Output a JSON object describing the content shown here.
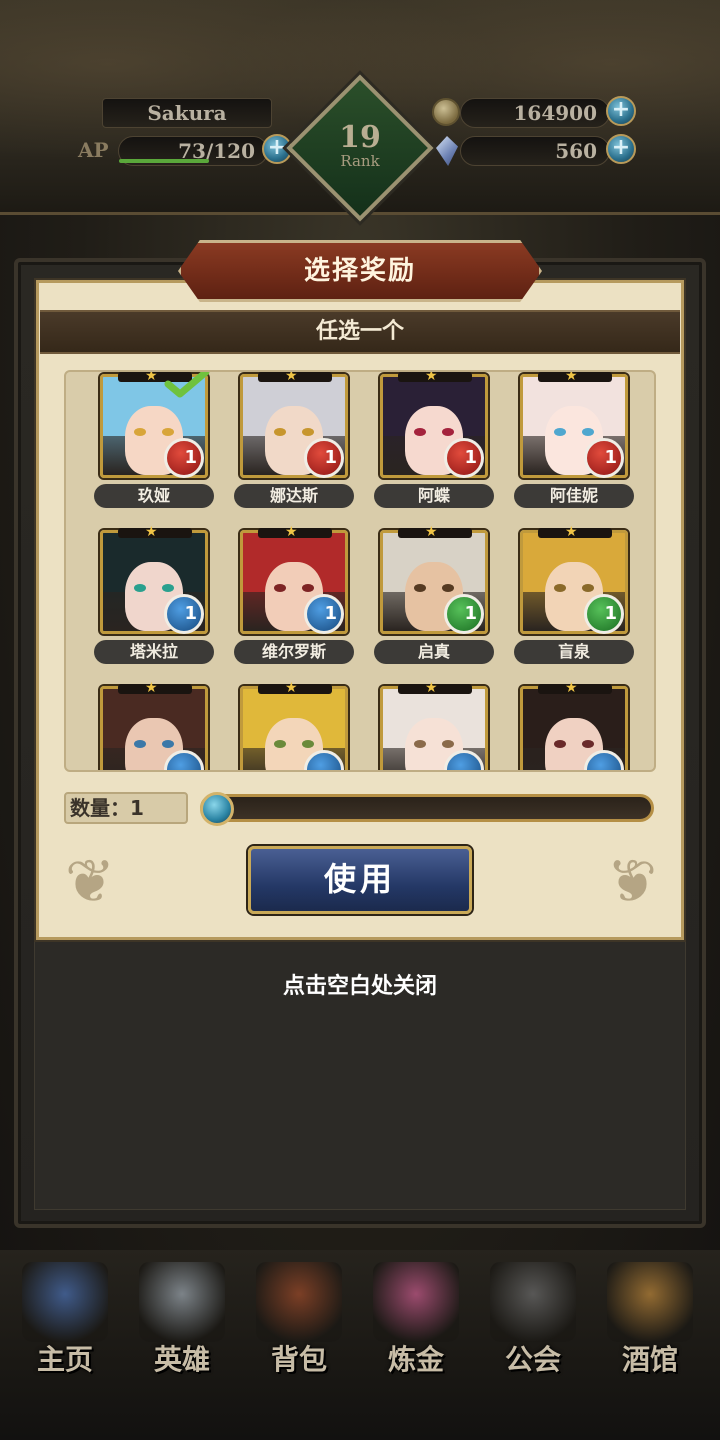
{
  "header": {
    "player_name": "Sakura",
    "ap_label": "AP",
    "ap_value": "73/120",
    "ap_fraction": 0.608,
    "gold": "164900",
    "gems": "560",
    "rank_number": "19",
    "rank_label": "Rank"
  },
  "dialog": {
    "title": "选择奖励",
    "subtitle": "任选一个",
    "heroes": [
      {
        "name": "玖娅",
        "badge": "1",
        "type": "red",
        "selected": true,
        "hair": "#7fc6e6",
        "skin": "#f6d7c5",
        "eye": "#d8a53a"
      },
      {
        "name": "娜达斯",
        "badge": "1",
        "type": "red",
        "selected": false,
        "hair": "#cfcfd6",
        "skin": "#f1d9c8",
        "eye": "#c7962e"
      },
      {
        "name": "阿蝶",
        "badge": "1",
        "type": "red",
        "selected": false,
        "hair": "#2a2036",
        "skin": "#f6d9cf",
        "eye": "#a4233d"
      },
      {
        "name": "阿佳妮",
        "badge": "1",
        "type": "red",
        "selected": false,
        "hair": "#f2e2de",
        "skin": "#fbe6de",
        "eye": "#4fa7cf"
      },
      {
        "name": "塔米拉",
        "badge": "1",
        "type": "blue",
        "selected": false,
        "hair": "#1a2a2c",
        "skin": "#f0d6cc",
        "eye": "#2aa08e"
      },
      {
        "name": "维尔罗斯",
        "badge": "1",
        "type": "blue",
        "selected": false,
        "hair": "#b12a2a",
        "skin": "#f2cdb8",
        "eye": "#7e2424"
      },
      {
        "name": "启真",
        "badge": "1",
        "type": "green",
        "selected": false,
        "hair": "#d8d2c6",
        "skin": "#e6c2a2",
        "eye": "#553a22"
      },
      {
        "name": "盲泉",
        "badge": "1",
        "type": "green",
        "selected": false,
        "hair": "#d9a93a",
        "skin": "#f2d4b6",
        "eye": "#8a6a2a"
      },
      {
        "name": "",
        "badge": "",
        "type": "blue",
        "selected": false,
        "hair": "#4a2a22",
        "skin": "#eac7b2",
        "eye": "#3b78a8"
      },
      {
        "name": "",
        "badge": "",
        "type": "blue",
        "selected": false,
        "hair": "#e0b83a",
        "skin": "#f3d6b9",
        "eye": "#6a8a3a"
      },
      {
        "name": "",
        "badge": "",
        "type": "blue",
        "selected": false,
        "hair": "#eae2dc",
        "skin": "#f6e1d6",
        "eye": "#8a6a4a"
      },
      {
        "name": "",
        "badge": "",
        "type": "blue",
        "selected": false,
        "hair": "#2a1e1a",
        "skin": "#f0d1c2",
        "eye": "#6a2a2a"
      }
    ],
    "quantity_label": "数量：",
    "quantity_value": "1",
    "use_button": "使用"
  },
  "close_hint": "点击空白处关闭",
  "nav": [
    {
      "label": "主页",
      "icon": "castle-icon",
      "color": "#4a6fb0"
    },
    {
      "label": "英雄",
      "icon": "helmet-icon",
      "color": "#9aa4ad"
    },
    {
      "label": "背包",
      "icon": "backpack-icon",
      "color": "#9a4a2a"
    },
    {
      "label": "炼金",
      "icon": "potion-icon",
      "color": "#c45a8a"
    },
    {
      "label": "公会",
      "icon": "guild-shield-icon",
      "color": "#6a6a6a"
    },
    {
      "label": "酒馆",
      "icon": "beer-mug-icon",
      "color": "#b8843a"
    }
  ]
}
